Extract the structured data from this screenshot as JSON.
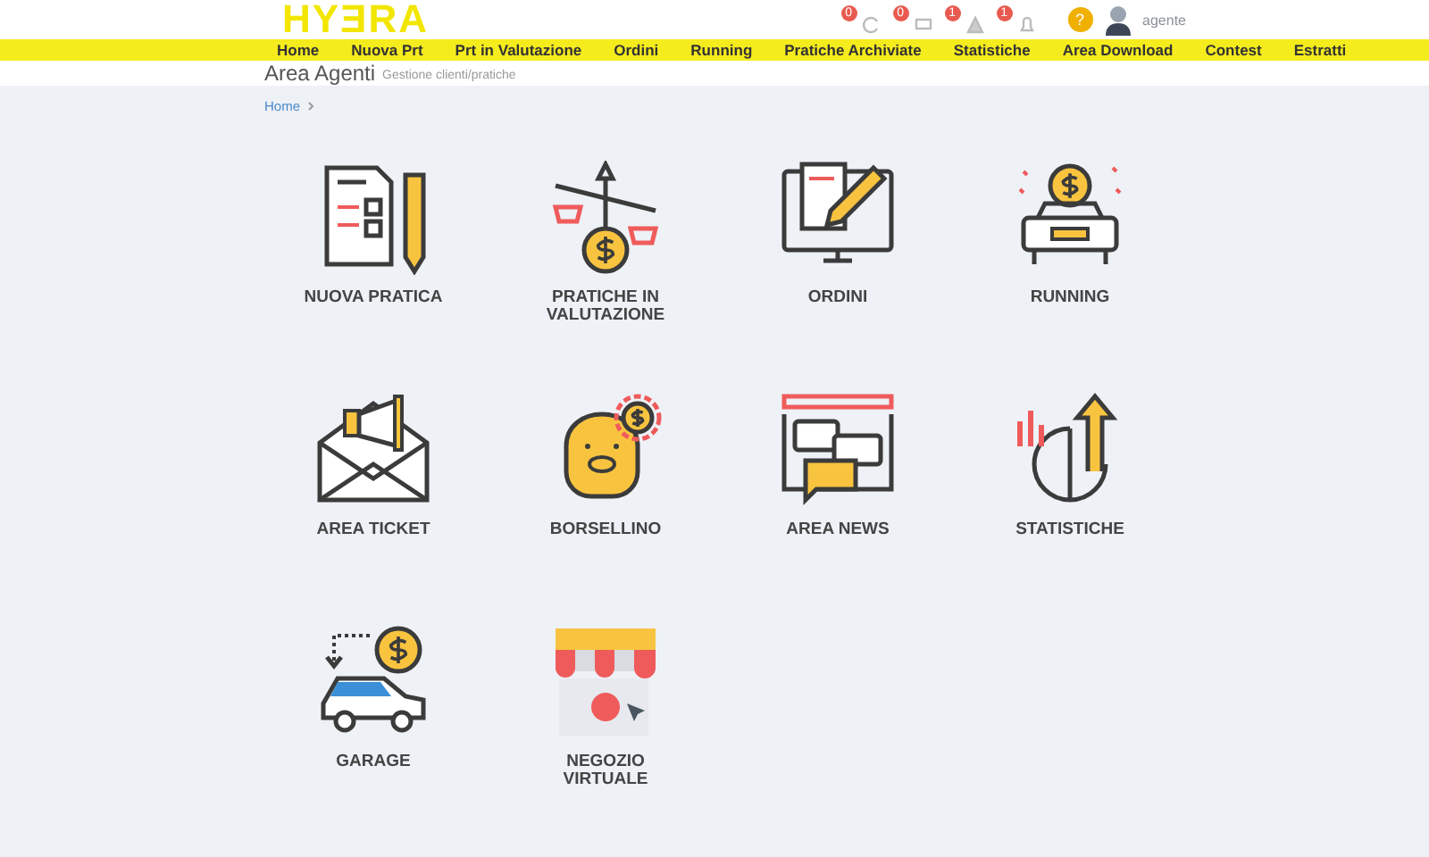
{
  "logo": {
    "text": "HYƎRA"
  },
  "header_icons": [
    {
      "kind": "refresh",
      "badge": "0"
    },
    {
      "kind": "chat",
      "badge": "0"
    },
    {
      "kind": "warning",
      "badge": "1"
    },
    {
      "kind": "bell",
      "badge": "1"
    }
  ],
  "help": {
    "label": "?"
  },
  "user": {
    "name": "agente"
  },
  "nav": [
    {
      "label": "Home"
    },
    {
      "label": "Nuova Prt"
    },
    {
      "label": "Prt in Valutazione"
    },
    {
      "label": "Ordini"
    },
    {
      "label": "Running"
    },
    {
      "label": "Pratiche Archiviate"
    },
    {
      "label": "Statistiche"
    },
    {
      "label": "Area Download"
    },
    {
      "label": "Contest"
    },
    {
      "label": "Estratti"
    }
  ],
  "page": {
    "title": "Area Agenti",
    "subtitle": "Gestione clienti/pratiche"
  },
  "breadcrumb": [
    {
      "label": "Home"
    }
  ],
  "tiles": [
    {
      "kind": "form",
      "label": "NUOVA PRATICA"
    },
    {
      "kind": "scale",
      "label": "PRATICHE IN VALUTAZIONE"
    },
    {
      "kind": "monitor",
      "label": "ORDINI"
    },
    {
      "kind": "car-coin",
      "label": "RUNNING"
    },
    {
      "kind": "envelope",
      "label": "AREA TICKET"
    },
    {
      "kind": "piggy",
      "label": "BORSELLINO"
    },
    {
      "kind": "chat",
      "label": "AREA NEWS"
    },
    {
      "kind": "chart",
      "label": "STATISTICHE"
    },
    {
      "kind": "garage",
      "label": "GARAGE"
    },
    {
      "kind": "shop",
      "label": "NEGOZIO VIRTUALE"
    }
  ]
}
